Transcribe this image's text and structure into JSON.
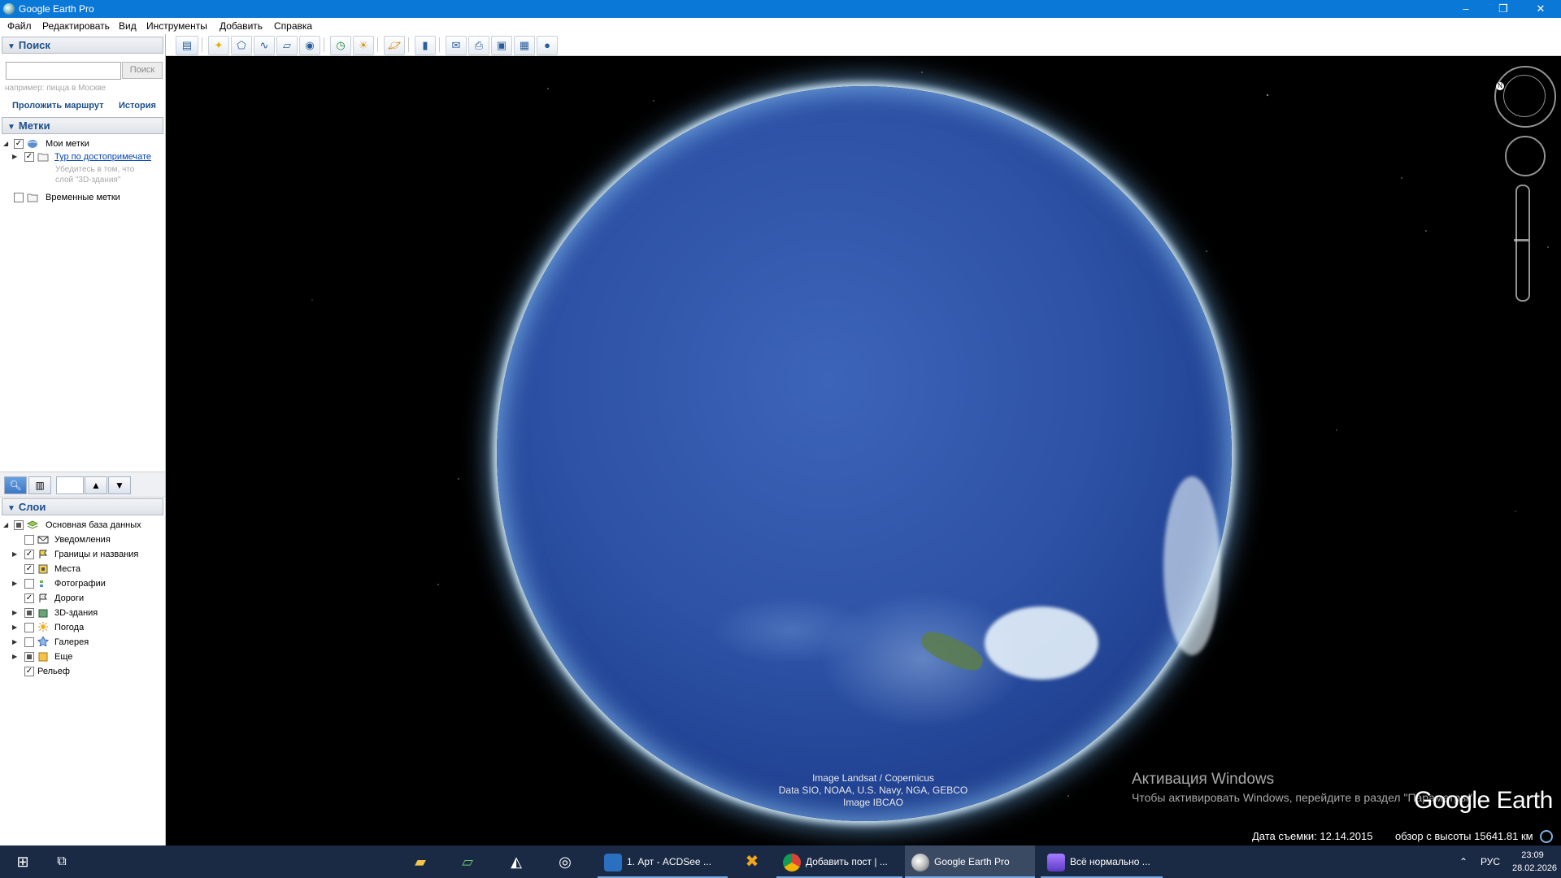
{
  "window": {
    "title": "Google Earth Pro",
    "minimize": "–",
    "restore": "❐",
    "close": "✕"
  },
  "menu": [
    "Файл",
    "Редактировать",
    "Вид",
    "Инструменты",
    "Добавить",
    "Справка"
  ],
  "search": {
    "header": "Поиск",
    "placeholder": "",
    "button": "Поиск",
    "hint": "например: пицца в Москве",
    "route_link": "Проложить маршрут",
    "history_link": "История"
  },
  "places": {
    "header": "Метки",
    "my_places": "Мои метки",
    "tour": "Тур по достопримечате",
    "tour_note": "Убедитесь в том, что слой \"3D-здания\"",
    "temporary": "Временные метки"
  },
  "layers": {
    "header": "Слои",
    "root": "Основная база данных",
    "items": [
      {
        "label": "Уведомления",
        "checked": false
      },
      {
        "label": "Границы и названия",
        "checked": true
      },
      {
        "label": "Места",
        "checked": true
      },
      {
        "label": "Фотографии",
        "checked": false
      },
      {
        "label": "Дороги",
        "checked": true
      },
      {
        "label": "3D-здания",
        "checked": "partial"
      },
      {
        "label": "Погода",
        "checked": false
      },
      {
        "label": "Галерея",
        "checked": false
      },
      {
        "label": "Еще",
        "checked": "partial"
      },
      {
        "label": "Рельеф",
        "checked": true
      }
    ]
  },
  "viewport": {
    "attribution": [
      "Image Landsat / Copernicus",
      "Data SIO, NOAA, U.S. Navy, NGA, GEBCO",
      "Image IBCAO"
    ],
    "activation_title": "Активация Windows",
    "activation_text": "Чтобы активировать Windows, перейдите в раздел \"Параметры\".",
    "logo": "Google Earth",
    "imagery_date": "Дата съемки: 12.14.2015",
    "eye_alt": "обзор с высоты 15641.81 км"
  },
  "taskbar": {
    "apps": [
      {
        "label": "1. Арт - ACDSee ..."
      },
      {
        "label": "Добавить пост | ..."
      },
      {
        "label": "Google Earth Pro"
      },
      {
        "label": "Всё нормально ..."
      }
    ],
    "lang": "РУС",
    "time": "23:09",
    "date": "28.02.2026"
  }
}
